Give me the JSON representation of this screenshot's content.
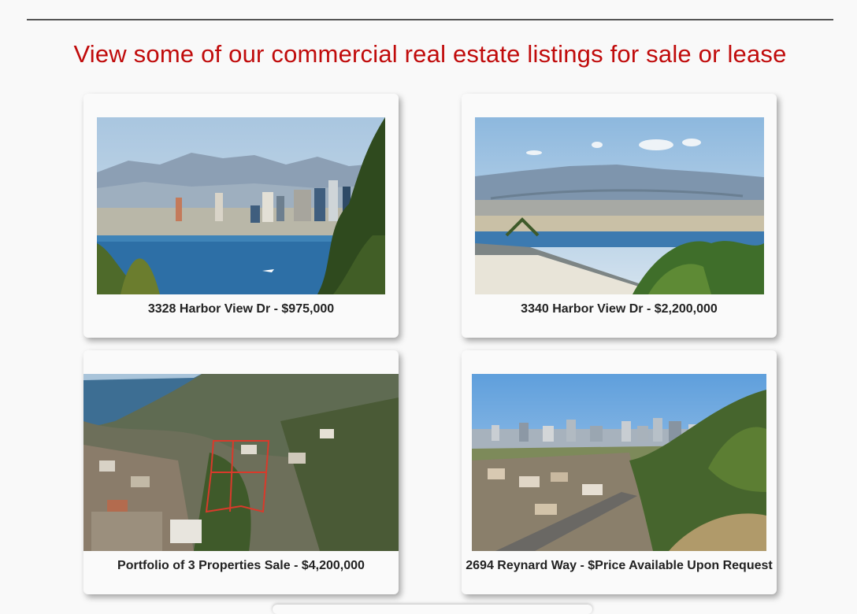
{
  "heading": "View some of our commercial real estate listings for sale or lease",
  "colors": {
    "heading": "#c00b0b",
    "caption": "#222222",
    "background": "#f9f9f9"
  },
  "listings": [
    {
      "caption": "3328 Harbor View Dr - $975,000",
      "photo": "city-skyline-bay-photo"
    },
    {
      "caption": "3340 Harbor View Dr - $2,200,000",
      "photo": "bay-bridge-airport-photo"
    },
    {
      "caption": "Portfolio of 3 Properties Sale - $4,200,000",
      "photo": "aerial-lot-outline-photo"
    },
    {
      "caption": "2694 Reynard Way - $Price Available Upon Request",
      "photo": "hillside-street-skyline-photo"
    }
  ]
}
